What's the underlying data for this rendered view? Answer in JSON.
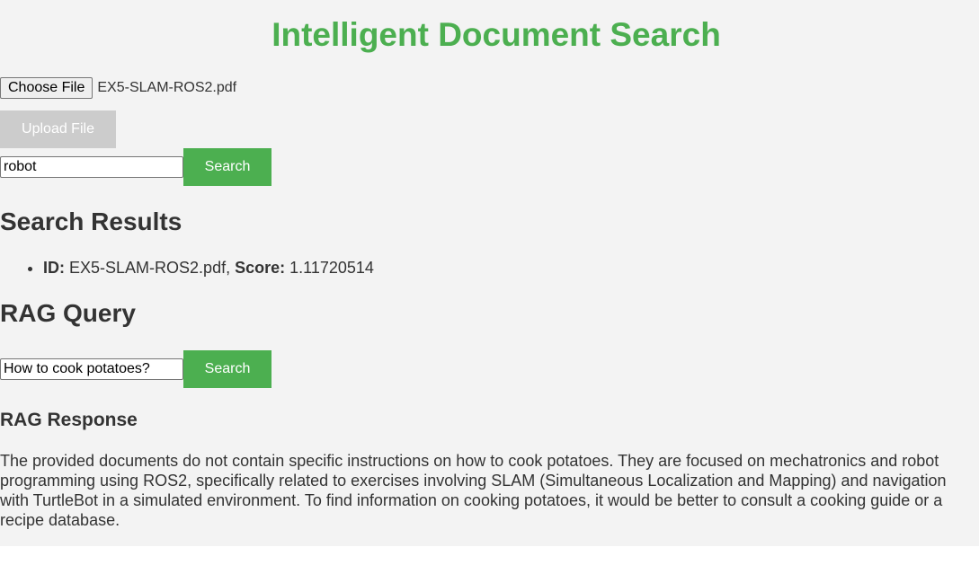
{
  "header": {
    "title": "Intelligent Document Search"
  },
  "upload": {
    "choose_label": "Choose File",
    "file_name": "EX5-SLAM-ROS2.pdf",
    "upload_label": "Upload File"
  },
  "search": {
    "input_value": "robot",
    "button_label": "Search"
  },
  "results": {
    "heading": "Search Results",
    "items": [
      {
        "id_label": "ID:",
        "id_value": "EX5-SLAM-ROS2.pdf,",
        "score_label": "Score:",
        "score_value": "1.11720514"
      }
    ]
  },
  "rag": {
    "heading": "RAG Query",
    "input_value": "How to cook potatoes?",
    "button_label": "Search",
    "response_heading": "RAG Response",
    "response_text": "The provided documents do not contain specific instructions on how to cook potatoes. They are focused on mechatronics and robot programming using ROS2, specifically related to exercises involving SLAM (Simultaneous Localization and Mapping) and navigation with TurtleBot in a simulated environment. To find information on cooking potatoes, it would be better to consult a cooking guide or a recipe database."
  },
  "colors": {
    "accent": "#4caf50",
    "background": "#f3f3f3",
    "disabled_button": "#cccccc",
    "text": "#333333"
  }
}
